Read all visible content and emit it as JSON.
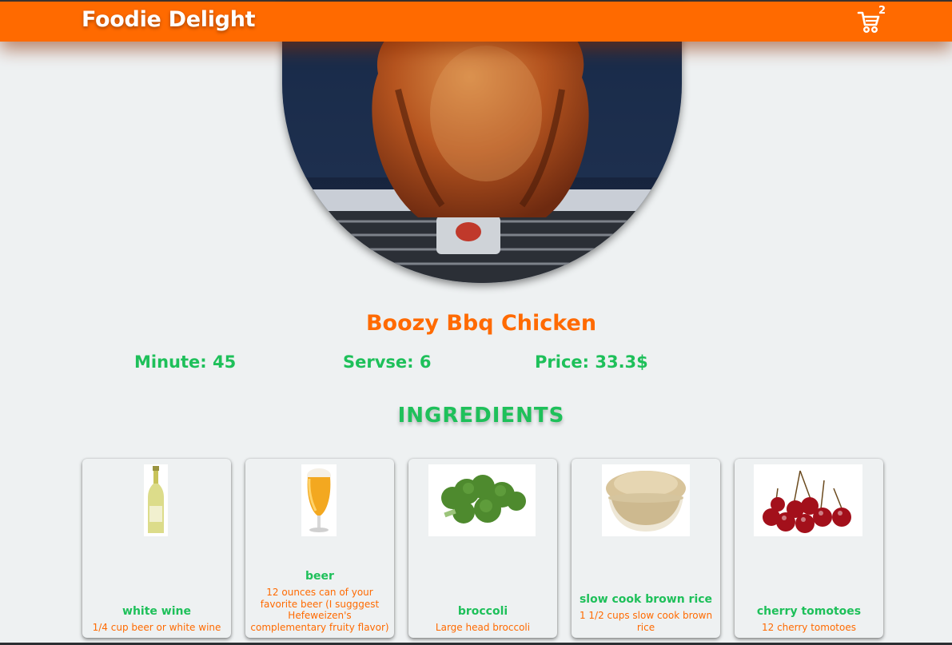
{
  "header": {
    "brand": "Foodie Delight",
    "cart_icon": "cart-icon",
    "cart_count": "2"
  },
  "hero": {
    "image": "boozy-bbq-chicken-photo"
  },
  "recipe": {
    "title": "Boozy Bbq Chicken",
    "minutes": "Minute: 45",
    "serves": "Servse: 6",
    "price": "Price: 33.3$"
  },
  "ingredients_heading": "INGREDIENTS",
  "ingredients": [
    {
      "name": "white wine",
      "amount": "1/4 cup beer or white wine",
      "image": "white-wine-bottle-photo"
    },
    {
      "name": "beer",
      "amount": "12 ounces can of your favorite beer (I sugggest Hefeweizen's complementary fruity flavor)",
      "image": "beer-glass-photo"
    },
    {
      "name": "broccoli",
      "amount": "Large head broccoli",
      "image": "broccoli-photo"
    },
    {
      "name": "slow cook brown rice",
      "amount": "1 1/2 cups slow cook brown rice",
      "image": "brown-rice-bowl-photo"
    },
    {
      "name": "cherry tomotoes",
      "amount": "12 cherry tomotoes",
      "image": "cherries-photo"
    }
  ],
  "colors": {
    "accent_orange": "#ff6a00",
    "accent_green": "#1ec05a",
    "background": "#eef1f2"
  }
}
